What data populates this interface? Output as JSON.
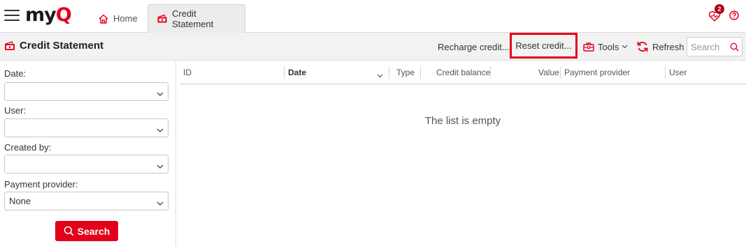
{
  "app": {
    "logo_text_main": "my",
    "logo_text_accent": "Q",
    "brand_color": "#e2001a"
  },
  "tabs": [
    {
      "label": "Home",
      "icon": "home-icon",
      "active": false
    },
    {
      "label": "Credit Statement",
      "icon": "credit-statement-icon",
      "active": true
    }
  ],
  "top_icons": {
    "health_badge_count": "2",
    "health_icon": "heart-pulse-icon",
    "help_icon": "help-circle-icon"
  },
  "toolbar": {
    "title": "Credit Statement",
    "recharge_label": "Recharge credit...",
    "reset_label": "Reset credit...",
    "tools_label": "Tools",
    "refresh_label": "Refresh",
    "search_placeholder": "Search"
  },
  "filters": {
    "date_label": "Date:",
    "date_value": "",
    "user_label": "User:",
    "user_value": "",
    "created_by_label": "Created by:",
    "created_by_value": "",
    "payment_provider_label": "Payment provider:",
    "payment_provider_value": "None",
    "search_button_label": "Search"
  },
  "grid": {
    "columns": [
      "ID",
      "Date",
      "Type",
      "Credit balance",
      "Value",
      "Payment provider",
      "User"
    ],
    "sorted_column": "Date",
    "empty_message": "The list is empty"
  }
}
